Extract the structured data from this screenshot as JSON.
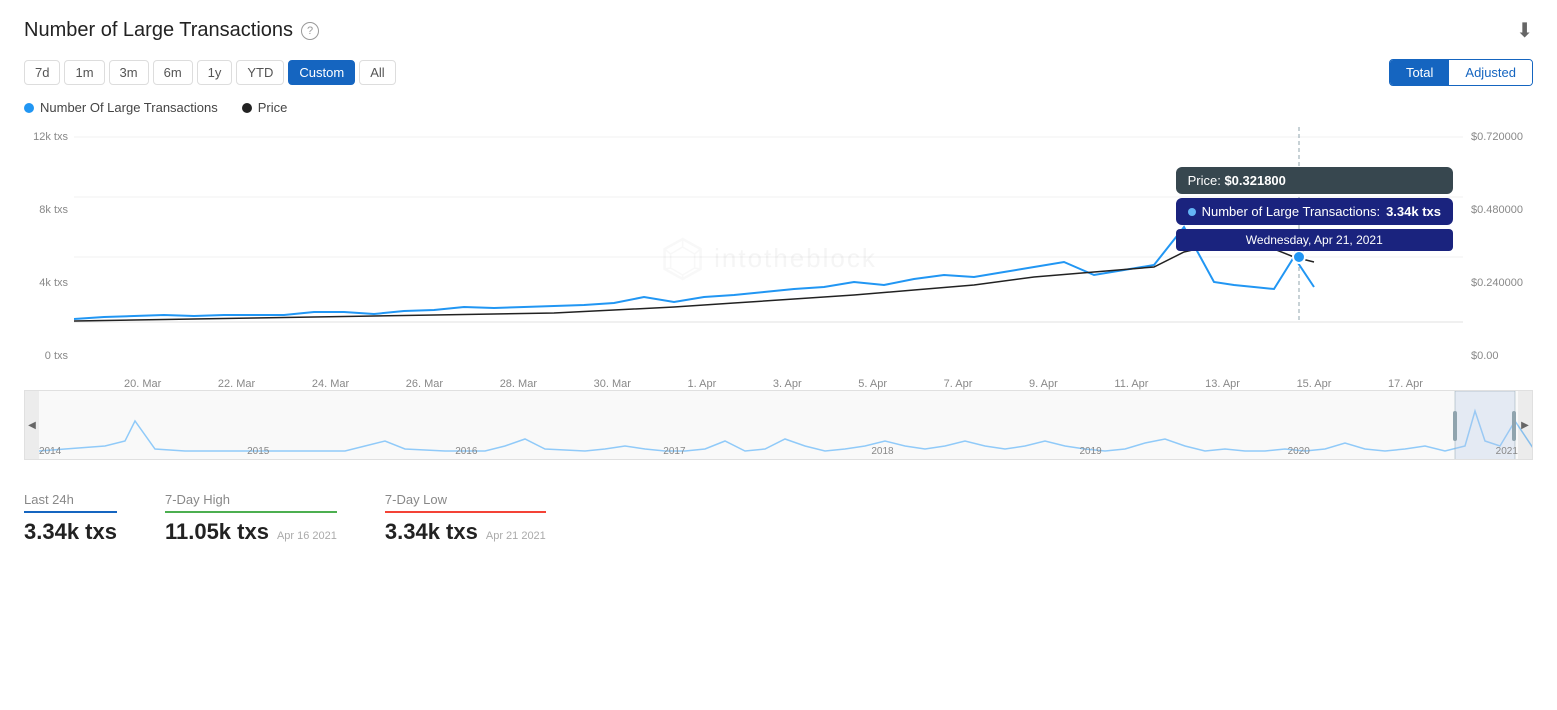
{
  "header": {
    "title": "Number of Large Transactions",
    "help_label": "?",
    "download_icon": "⬇"
  },
  "time_buttons": [
    {
      "label": "7d",
      "active": false
    },
    {
      "label": "1m",
      "active": false
    },
    {
      "label": "3m",
      "active": false
    },
    {
      "label": "6m",
      "active": false
    },
    {
      "label": "1y",
      "active": false
    },
    {
      "label": "YTD",
      "active": false
    },
    {
      "label": "Custom",
      "active": true
    },
    {
      "label": "All",
      "active": false
    }
  ],
  "toggle_buttons": [
    {
      "label": "Total",
      "active": true
    },
    {
      "label": "Adjusted",
      "active": false
    }
  ],
  "legend": [
    {
      "label": "Number Of Large Transactions",
      "color": "blue"
    },
    {
      "label": "Price",
      "color": "dark"
    }
  ],
  "y_axis_left": [
    "12k txs",
    "8k txs",
    "4k txs",
    "0 txs"
  ],
  "y_axis_right": [
    "$0.720000",
    "$0.480000",
    "$0.240000",
    "$0.00"
  ],
  "x_axis_labels": [
    "20. Mar",
    "22. Mar",
    "24. Mar",
    "26. Mar",
    "28. Mar",
    "30. Mar",
    "1. Apr",
    "3. Apr",
    "5. Apr",
    "7. Apr",
    "9. Apr",
    "11. Apr",
    "13. Apr",
    "15. Apr",
    "17. Apr"
  ],
  "mini_year_labels": [
    "2014",
    "2015",
    "2016",
    "2017",
    "2018",
    "2019",
    "2020",
    "2021"
  ],
  "tooltip": {
    "price_label": "Price:",
    "price_value": "$0.321800",
    "txs_label": "Number of Large Transactions:",
    "txs_value": "3.34k txs",
    "date": "Wednesday, Apr 21, 2021"
  },
  "stats": [
    {
      "label": "Last 24h",
      "value": "3.34k txs",
      "date": "",
      "underline": "blue"
    },
    {
      "label": "7-Day High",
      "value": "11.05k txs",
      "date": "Apr 16 2021",
      "underline": "green"
    },
    {
      "label": "7-Day Low",
      "value": "3.34k txs",
      "date": "Apr 21 2021",
      "underline": "red"
    }
  ],
  "watermark_text": "intotheblock"
}
